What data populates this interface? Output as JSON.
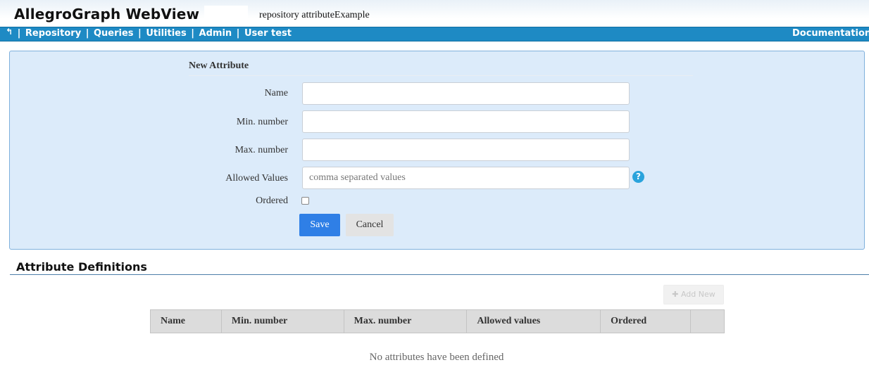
{
  "header": {
    "app_title": "AllegroGraph WebView",
    "repository_label": "repository attributeExample"
  },
  "nav": {
    "back_icon": "↰",
    "items": [
      "Repository",
      "Queries",
      "Utilities",
      "Admin",
      "User test"
    ],
    "documentation": "Documentation"
  },
  "form": {
    "legend": "New Attribute",
    "name_label": "Name",
    "min_label": "Min. number",
    "max_label": "Max. number",
    "allowed_label": "Allowed Values",
    "allowed_placeholder": "comma separated values",
    "ordered_label": "Ordered",
    "save_label": "Save",
    "cancel_label": "Cancel"
  },
  "definitions": {
    "title": "Attribute Definitions",
    "add_new_label": "✚ Add New",
    "columns": [
      "Name",
      "Min. number",
      "Max. number",
      "Allowed values",
      "Ordered",
      ""
    ],
    "empty_message": "No attributes have been defined"
  },
  "colors": {
    "nav_bar": "#1e8ac4",
    "panel_bg": "#dcebfa",
    "save_button": "#2f7fe6",
    "help_icon": "#2aa3dc"
  }
}
